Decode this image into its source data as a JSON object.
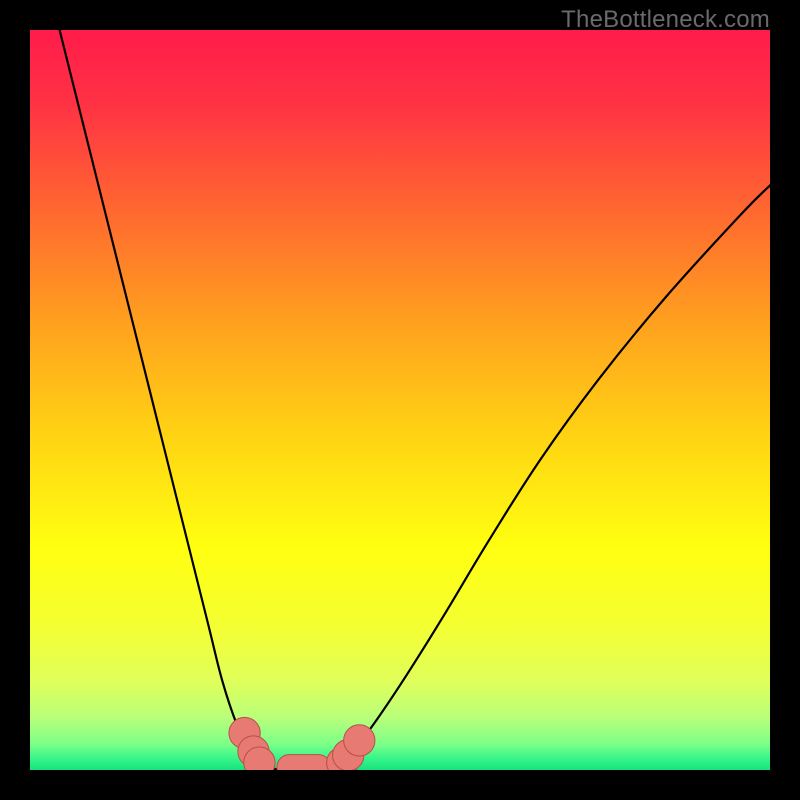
{
  "watermark": "TheBottleneck.com",
  "chart_data": {
    "type": "line",
    "title": "",
    "xlabel": "",
    "ylabel": "",
    "xlim": [
      0,
      100
    ],
    "ylim": [
      0,
      100
    ],
    "grid": false,
    "legend": false,
    "series": [
      {
        "name": "left-curve",
        "x": [
          4,
          8,
          12,
          16,
          20,
          24,
          26,
          28,
          29.5,
          31,
          33.5
        ],
        "y": [
          100,
          84,
          68,
          52,
          36,
          20,
          12,
          6,
          3,
          1,
          0
        ]
      },
      {
        "name": "right-curve",
        "x": [
          40.5,
          42,
          44,
          47,
          51,
          56,
          62,
          69,
          77,
          86,
          96,
          100
        ],
        "y": [
          0,
          1,
          3,
          7,
          13,
          21,
          31,
          42,
          53,
          64,
          75,
          79
        ]
      },
      {
        "name": "trough-flat",
        "x": [
          33.5,
          40.5
        ],
        "y": [
          0,
          0
        ]
      }
    ],
    "markers": [
      {
        "name": "dot-left-upper",
        "x": 29.0,
        "y": 5.0,
        "r": 1.6
      },
      {
        "name": "dot-left-mid",
        "x": 30.2,
        "y": 2.5,
        "r": 1.6
      },
      {
        "name": "dot-left-lower",
        "x": 31.0,
        "y": 1.0,
        "r": 1.6
      },
      {
        "name": "dot-right-lower",
        "x": 42.2,
        "y": 1.0,
        "r": 1.6
      },
      {
        "name": "dot-right-mid",
        "x": 43.0,
        "y": 2.0,
        "r": 1.6
      },
      {
        "name": "dot-right-upper",
        "x": 44.5,
        "y": 4.0,
        "r": 1.6
      },
      {
        "name": "trough-pill-1",
        "x": 34.0,
        "y": 0.0,
        "r": 1.4
      },
      {
        "name": "trough-pill-2",
        "x": 36.0,
        "y": 0.0,
        "r": 1.4
      },
      {
        "name": "trough-pill-3",
        "x": 38.0,
        "y": 0.0,
        "r": 1.4
      },
      {
        "name": "trough-pill-4",
        "x": 40.0,
        "y": 0.0,
        "r": 1.4
      }
    ],
    "background_gradient": {
      "stops": [
        {
          "offset": 0.0,
          "color": "#ff1c4b"
        },
        {
          "offset": 0.1,
          "color": "#ff3244"
        },
        {
          "offset": 0.25,
          "color": "#ff6a2f"
        },
        {
          "offset": 0.4,
          "color": "#ffa21e"
        },
        {
          "offset": 0.55,
          "color": "#ffd413"
        },
        {
          "offset": 0.7,
          "color": "#ffff10"
        },
        {
          "offset": 0.8,
          "color": "#f5ff30"
        },
        {
          "offset": 0.88,
          "color": "#e0ff5a"
        },
        {
          "offset": 0.93,
          "color": "#b8ff7a"
        },
        {
          "offset": 0.965,
          "color": "#7cff88"
        },
        {
          "offset": 0.985,
          "color": "#35f58a"
        },
        {
          "offset": 1.0,
          "color": "#17e37d"
        }
      ]
    },
    "line_color": "#000000",
    "marker_color": "#e77a72",
    "marker_stroke": "#b94f48"
  }
}
